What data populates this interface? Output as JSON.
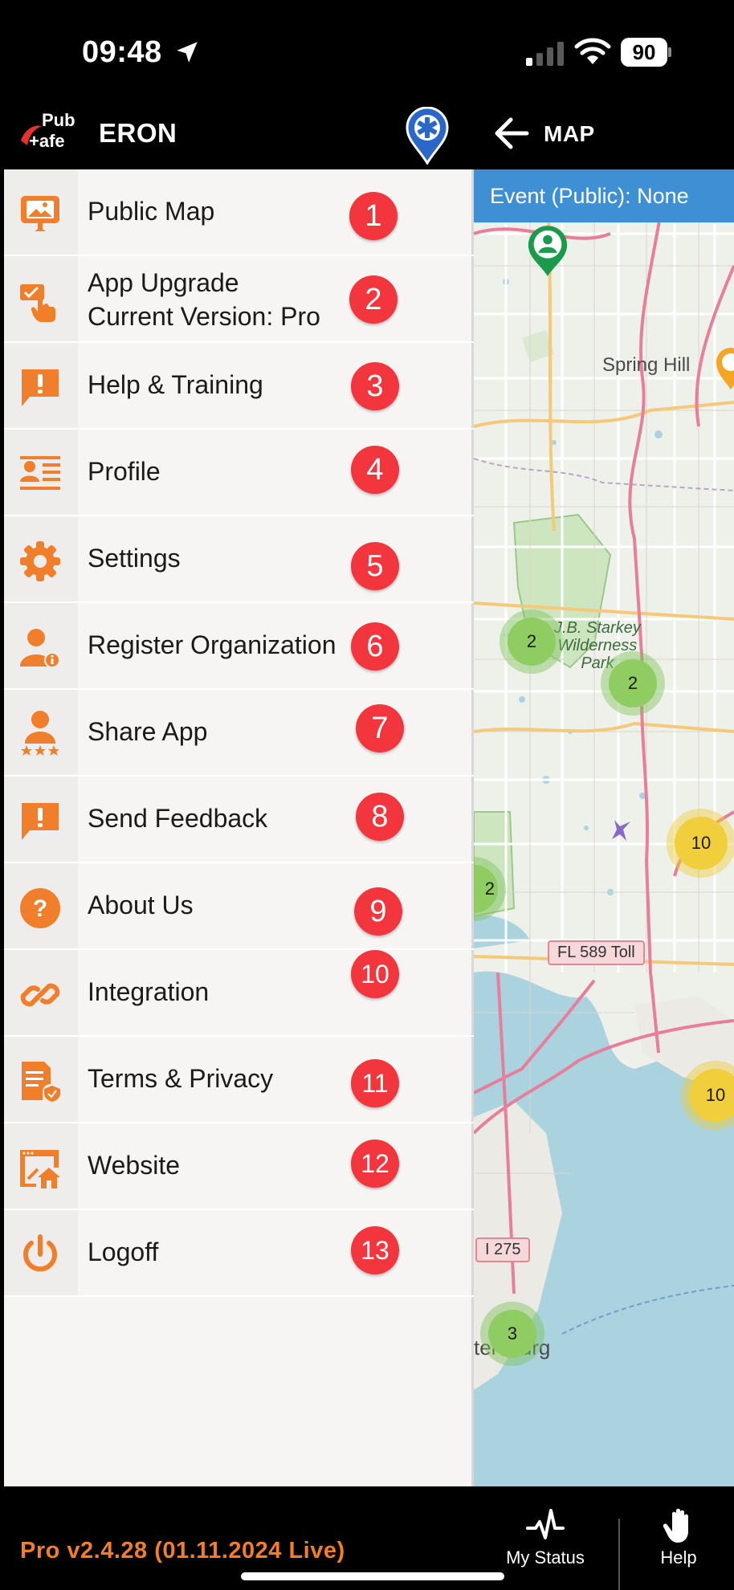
{
  "status_bar": {
    "time": "09:48",
    "battery": "90"
  },
  "header": {
    "logo_text_top": "Pub",
    "logo_text_bottom": "+afe",
    "app_name": "ERON",
    "map_title": "MAP"
  },
  "menu": {
    "items": [
      {
        "label": "Public Map",
        "badge": "1",
        "icon": "public-map-icon"
      },
      {
        "label": "App Upgrade",
        "sublabel": "Current Version: Pro",
        "badge": "2",
        "icon": "upgrade-touch-icon"
      },
      {
        "label": "Help & Training",
        "badge": "3",
        "icon": "alert-chat-icon"
      },
      {
        "label": "Profile",
        "badge": "4",
        "icon": "id-card-icon"
      },
      {
        "label": "Settings",
        "badge": "5",
        "icon": "gear-icon"
      },
      {
        "label": "Register Organization",
        "badge": "6",
        "icon": "person-info-icon"
      },
      {
        "label": "Share App",
        "badge": "7",
        "icon": "person-stars-icon"
      },
      {
        "label": "Send Feedback",
        "badge": "8",
        "icon": "feedback-chat-icon"
      },
      {
        "label": "About Us",
        "badge": "9",
        "icon": "question-icon"
      },
      {
        "label": "Integration",
        "badge": "10",
        "icon": "link-icon"
      },
      {
        "label": "Terms & Privacy",
        "badge": "11",
        "icon": "document-shield-icon"
      },
      {
        "label": "Website",
        "badge": "12",
        "icon": "browser-home-icon"
      },
      {
        "label": "Logoff",
        "badge": "13",
        "icon": "power-icon"
      }
    ]
  },
  "map": {
    "event_label": "Event (Public): None",
    "labels": {
      "spring_hill": "Spring Hill",
      "park_1": "J.B. Starkey",
      "park_2": "Wilderness",
      "park_3": "Park",
      "fl589": "FL 589 Toll",
      "i275": "I 275",
      "petersburg": "tersburg"
    },
    "clusters": [
      "2",
      "2",
      "10",
      "2",
      "10",
      "3"
    ]
  },
  "footer": {
    "version": "Pro v2.4.28 (01.11.2024 Live)",
    "tabs": [
      {
        "label": "My Status",
        "icon": "pulse-icon"
      },
      {
        "label": "Help",
        "icon": "hand-icon"
      }
    ]
  },
  "colors": {
    "accent_orange": "#f07e2a",
    "badge_red": "#f3363e",
    "event_blue": "#3f8fd4"
  }
}
